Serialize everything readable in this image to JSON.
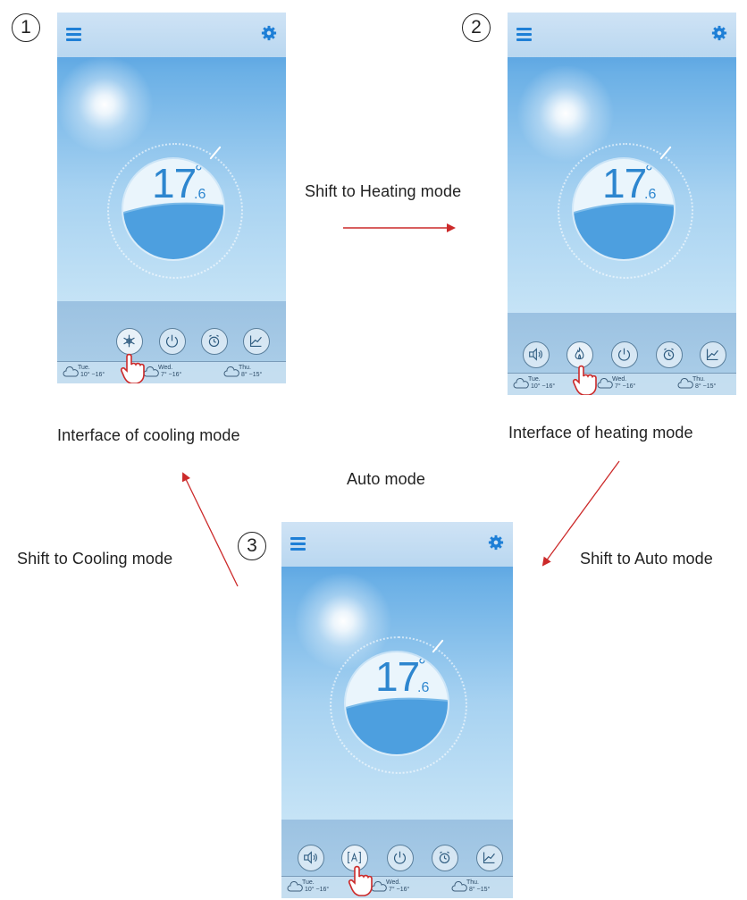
{
  "steps": [
    "1",
    "2",
    "3"
  ],
  "captions": {
    "arrow_1_2": "Shift to Heating mode",
    "interface_cooling": "Interface of cooling mode",
    "interface_heating": "Interface of heating mode",
    "auto_mode": "Auto mode",
    "arrow_3_1": "Shift to Cooling mode",
    "arrow_2_3": "Shift to Auto mode"
  },
  "screen": {
    "temperature": "17",
    "degree": "°",
    "decimal": ".6",
    "forecast": [
      {
        "day": "Tue.",
        "range": "10° ~16°"
      },
      {
        "day": "Wed.",
        "range": "7° ~16°"
      },
      {
        "day": "Thu.",
        "range": "8° ~15°"
      }
    ]
  },
  "screens": [
    {
      "id": "cooling",
      "buttons": [
        "snowflake-icon",
        "power-icon",
        "alarm-clock-icon",
        "chart-icon"
      ],
      "pressed": "snowflake-icon"
    },
    {
      "id": "heating",
      "buttons": [
        "speaker-icon",
        "flame-icon",
        "power-icon",
        "alarm-clock-icon",
        "chart-icon"
      ],
      "pressed": "flame-icon"
    },
    {
      "id": "auto",
      "buttons": [
        "speaker-icon",
        "auto-icon",
        "power-icon",
        "alarm-clock-icon",
        "chart-icon"
      ],
      "pressed": "auto-icon"
    }
  ],
  "colors": {
    "accent_blue": "#2d86cf",
    "arrow_red": "#cc2a2a",
    "sky_top": "#3d8fd9",
    "sky_bottom": "#d2e9f6"
  }
}
